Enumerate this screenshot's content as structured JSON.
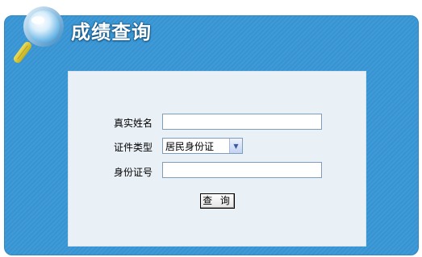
{
  "header": {
    "title": "成绩查询"
  },
  "form": {
    "name_label": "真实姓名",
    "name_value": "",
    "id_type_label": "证件类型",
    "id_type_selected": "居民身份证",
    "id_number_label": "身份证号",
    "id_number_value": "",
    "submit_label": "查 询"
  },
  "colors": {
    "panel": "#3f9ad6",
    "form_background": "#e9f1f7",
    "title_text": "#ffffff"
  },
  "icons": {
    "header_icon": "magnifier-icon",
    "select_arrow": "chevron-down-icon"
  }
}
